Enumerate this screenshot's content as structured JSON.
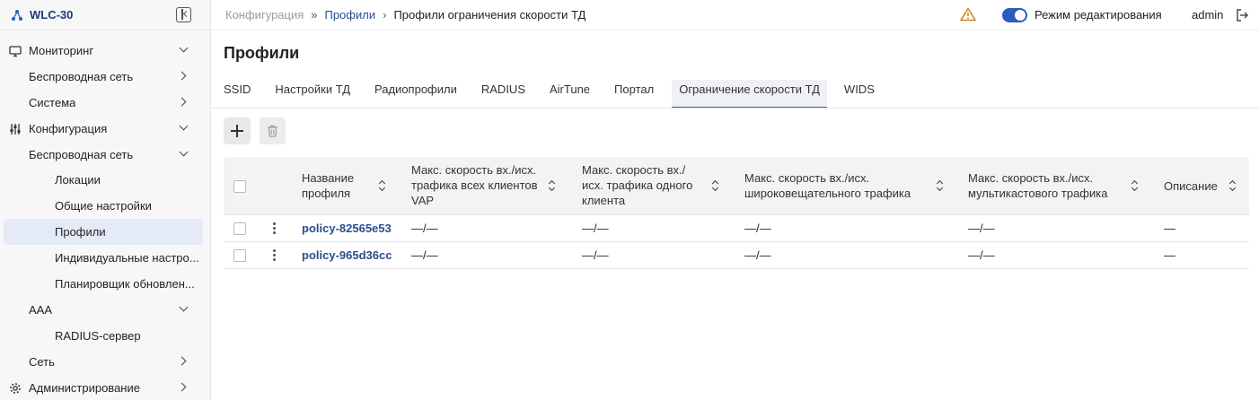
{
  "app": {
    "name": "WLC-30"
  },
  "sidebar": {
    "items": [
      {
        "label": "Мониторинг",
        "icon": "monitor-icon",
        "chevron": "down"
      },
      {
        "label": "Беспроводная сеть",
        "chevron": "right"
      },
      {
        "label": "Система",
        "chevron": "right"
      },
      {
        "label": "Конфигурация",
        "icon": "sliders-icon",
        "chevron": "down"
      },
      {
        "label": "Беспроводная сеть",
        "chevron": "down"
      },
      {
        "label": "Локации"
      },
      {
        "label": "Общие настройки"
      },
      {
        "label": "Профили",
        "active": true
      },
      {
        "label": "Индивидуальные настро..."
      },
      {
        "label": "Планировщик обновлен..."
      },
      {
        "label": "AAA",
        "chevron": "down"
      },
      {
        "label": "RADIUS-сервер"
      },
      {
        "label": "Сеть",
        "chevron": "right"
      },
      {
        "label": "Администрирование",
        "icon": "gear-icon",
        "chevron": "right"
      }
    ]
  },
  "breadcrumb": {
    "root": "Конфигурация",
    "parent": "Профили",
    "current": "Профили ограничения скорости ТД",
    "separator_1": "»",
    "separator_2": "›"
  },
  "topbar": {
    "edit_mode_label": "Режим редактирования",
    "edit_mode_on": true,
    "user": "admin"
  },
  "page": {
    "title": "Профили",
    "tabs": [
      "SSID",
      "Настройки ТД",
      "Радиопрофили",
      "RADIUS",
      "AirTune",
      "Портал",
      "Ограничение скорости ТД",
      "WIDS"
    ],
    "active_tab": "Ограничение скорости ТД"
  },
  "table": {
    "columns": [
      {
        "line1": "Название",
        "line2": "профиля",
        "line3": ""
      },
      {
        "line1": "Макс. скорость вх./исх.",
        "line2": "трафика всех клиентов",
        "line3": "VAP"
      },
      {
        "line1": "Макс. скорость вх./",
        "line2": "исх. трафика одного",
        "line3": "клиента"
      },
      {
        "line1": "Макс. скорость вх./исх.",
        "line2": "широковещательного трафика",
        "line3": ""
      },
      {
        "line1": "Макс. скорость вх./исх.",
        "line2": "мультикастового трафика",
        "line3": ""
      },
      {
        "line1": "Описание",
        "line2": "",
        "line3": ""
      }
    ],
    "rows": [
      {
        "name": "policy-82565e53",
        "all_vap": "—/—",
        "one_client": "—/—",
        "broadcast": "—/—",
        "multicast": "—/—",
        "description": "—"
      },
      {
        "name": "policy-965d36cc",
        "all_vap": "—/—",
        "one_client": "—/—",
        "broadcast": "—/—",
        "multicast": "—/—",
        "description": "—"
      }
    ]
  },
  "colors": {
    "accent": "#2d5bbd",
    "link": "#2a4f8f",
    "warning": "#d9822b",
    "active_bg": "#e4ebf7"
  }
}
